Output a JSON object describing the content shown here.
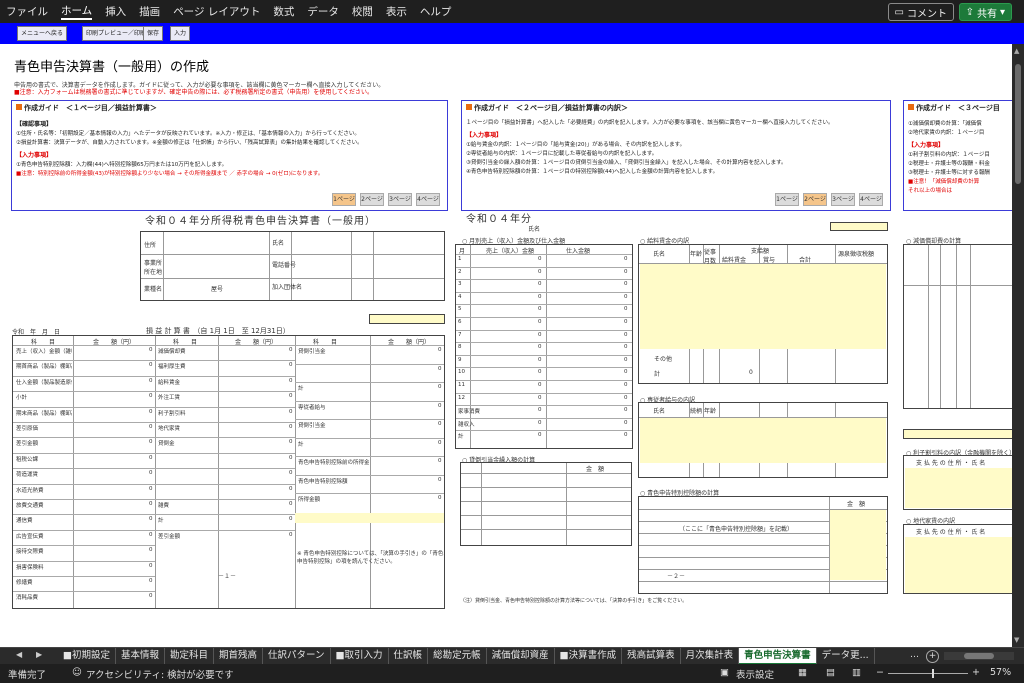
{
  "menu": {
    "items": [
      "ファイル",
      "ホーム",
      "挿入",
      "描画",
      "ページ レイアウト",
      "数式",
      "データ",
      "校閲",
      "表示",
      "ヘルプ"
    ],
    "active": "ホーム",
    "comment": "コメント",
    "share": "共有"
  },
  "toolbar": {
    "buttons": [
      "メニューへ戻る",
      "印刷プレビュー／印刷",
      "保存",
      "入力"
    ]
  },
  "sheet": {
    "title": "青色申告決算書（一般用）の作成",
    "notes": [
      "申告用の書式で、決算書データを作成します。ガイドに従って、入力が必要な事項を、該当欄に黄色マーカー欄へ直接入力してください。",
      "■注意：入力フォームは税務署の書式に準じていますが、確定申告の際には、必ず税務署所定の書式（申告用）を使用してください。"
    ],
    "guide1": {
      "title": "作成ガイド　＜１ページ目／損益計算書＞",
      "h1": "【確認事項】",
      "l1": [
        "①住所・氏名等：「初期設定／基本情報の入力」へたデータが反映されています。※入力・修正は、「基本情報の入力」から行ってください。",
        "②損益計算書：決算データが、自動入力されています。※金額の修正は「仕訳帳」から行い、「残高試算表」の集計結果を確認してください。"
      ],
      "h2": "【入力事項】",
      "l2": [
        "①青色申告特別控除額：入力欄(44)へ特別控除額65万円または10万円を記入します。"
      ],
      "l3": "■注意：特別控除前の所得金額(43)が特別控除額より少ない場合 → その所得金額まで ／ 赤字の場合 → 0(ゼロ)になります。",
      "pages": [
        "1ページ",
        "2ページ",
        "3ページ",
        "4ページ"
      ],
      "active": "1ページ"
    },
    "guide2": {
      "title": "作成ガイド　＜２ページ目／損益計算書の内訳＞",
      "l0": "１ページ目の「損益計算書」へ記入した「必要経費」の内訳を記入します。入力が必要な事項を、該当欄に黄色マーカー欄へ直接入力してください。",
      "h2": "【入力事項】",
      "l2": [
        "①給与賃金の内訳：１ページ目の「給与賃金(20)」がある場合、その内訳を記入します。",
        "②専従者給与の内訳：１ページ目に記載した専従者給与の内訳を記入します。",
        "③貸倒引当金の繰入額の計算：１ページ目の貸倒引当金の繰入、「貸倒引当金繰入」を記入した場合、その計算内容を記入します。",
        "④青色申告特別控除額の計算：１ページ目の特別控除額(44)へ記入した金額の計算内容を記入します。"
      ],
      "pages": [
        "1ページ",
        "2ページ",
        "3ページ",
        "4ページ"
      ],
      "active": "2ページ"
    },
    "guide3": {
      "title": "作成ガイド　＜３ページ目",
      "l1": [
        "①減価償却費の計算：「減価償",
        "②地代家賃の内訳：１ページ目"
      ],
      "h2": "【入力事項】",
      "l2": [
        "①利子割引料の内訳：１ページ目",
        "②税理士・弁護士等の報酬・料金",
        "③税理士・弁護士等に対する報酬"
      ],
      "l3": [
        "■注意！「減価償却費の計算",
        "それ以上の場合は"
      ]
    },
    "form1": {
      "title": "令和０４年分所得税青色申告決算書（一般用）",
      "era": "令和",
      "year": "０４",
      "fields": [
        "住所",
        "事業所所在地",
        "氏名",
        "電話番号",
        "業種名",
        "屋号",
        "加入団体名"
      ],
      "pl_title": "損 益 計 算 書　（自 1月 1日　至 12月31日）",
      "date": "令和　年　月　日",
      "col_item": "科　　目",
      "col_amount": "金　　額（円）",
      "rows1": [
        "売上（収入）金額（雑収入を含む）",
        "期首商品（製品）棚卸高",
        "仕入金額（製品製造原価）",
        "小計",
        "期末商品（製品）棚卸高",
        "差引原価",
        "差引金額",
        "租税公課",
        "荷造運賃",
        "水道光熱費",
        "旅費交通費",
        "通信費",
        "広告宣伝費",
        "接待交際費",
        "損害保険料",
        "修繕費",
        "消耗品費"
      ],
      "rows2": [
        "減価償却費",
        "福利厚生費",
        "給料賃金",
        "外注工賃",
        "利子割引料",
        "地代家賃",
        "貸倒金",
        "",
        "",
        "",
        "雑費",
        "計",
        "差引金額"
      ],
      "rows3": [
        "貸倒引当金",
        "",
        "計",
        "専従者給与",
        "貸倒引当金",
        "計",
        "青色申告特別控除前の所得金額",
        "青色申告特別控除額",
        "所得金額"
      ],
      "zero": "0",
      "pagenum": "－１－",
      "footnote": "※ 青色申告特別控除については、「決算の手引き」の「青色申告特別控除」の項を読んでください。"
    },
    "form2": {
      "era": "令和",
      "year": "０４",
      "suffix": "年分",
      "name_label": "氏名",
      "s1": "○ 月別売上（収入）金額及び仕入金額",
      "s1_cols": [
        "月",
        "売上（収入）金額",
        "仕入金額"
      ],
      "months": [
        "1",
        "2",
        "3",
        "4",
        "5",
        "6",
        "7",
        "8",
        "9",
        "10",
        "11",
        "12"
      ],
      "extra": [
        "家事消費",
        "雑収入",
        "計"
      ],
      "s2": "○ 給料賃金の内訳",
      "s2_cols": [
        "氏名",
        "年齢",
        "従事月数",
        "支給額",
        "源泉徴収税額"
      ],
      "s2_cols2": [
        "給料賃金",
        "賞与",
        "合計"
      ],
      "s2_foot": [
        "その他",
        "計"
      ],
      "s3": "○ 専従者給与の内訳",
      "s3_cols": [
        "氏名",
        "続柄",
        "年齢",
        "従事月数"
      ],
      "s4": "○ 貸倒引当金繰入額の計算",
      "s4_col": "金　額",
      "s5": "○ 青色申告特別控除額の計算",
      "s5_col": "金　額",
      "s5_note": "（ここに「青色申告特別控除額」を記載）",
      "footnote": "（注）貸倒引当金、青色申告特別控除額の計算方法等については、「決算の手引き」をご覧ください。",
      "zero": "0",
      "pagenum": "－２－"
    },
    "form3": {
      "s1": "○ 減価償却費の計算",
      "s2": "○ 利子割引料の内訳（金融機関を除く）",
      "s2_col": "支 払 先 の 住 所 ・ 氏 名",
      "s3": "○ 地代家賃の内訳",
      "s3_col": "支 払 先 の 住 所 ・ 氏 名"
    }
  },
  "tabs": {
    "items": [
      "■初期設定",
      "基本情報",
      "勘定科目",
      "期首残高",
      "仕訳パターン",
      "■取引入力",
      "仕訳帳",
      "総勘定元帳",
      "減価償却資産",
      "■決算書作成",
      "残高試算表",
      "月次集計表",
      "青色申告決算書",
      "データ更..."
    ],
    "active": "青色申告決算書",
    "add": "+",
    "more": "…"
  },
  "status": {
    "ready": "準備完了",
    "accessibility": "アクセシビリティ: 検討が必要です",
    "display_settings": "表示設定",
    "zoom": "57%"
  }
}
